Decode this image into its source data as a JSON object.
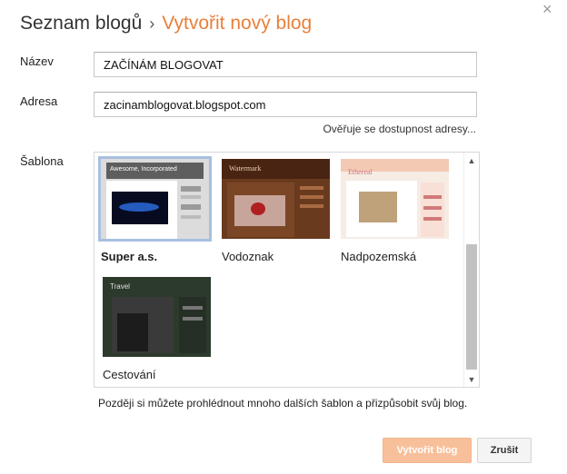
{
  "header": {
    "crumb": "Seznam blogů",
    "separator": "›",
    "current": "Vytvořit nový blog",
    "close_glyph": "×"
  },
  "form": {
    "name_label": "Název",
    "name_value": "ZAČÍNÁM BLOGOVAT",
    "address_label": "Adresa",
    "address_value": "zacinamblogovat.blogspot.com",
    "availability_hint": "Ověřuje se dostupnost adresy...",
    "template_label": "Šablona"
  },
  "templates": [
    {
      "name": "Super a.s.",
      "selected": true,
      "thumb_title": "Awesome, Incorporated"
    },
    {
      "name": "Vodoznak",
      "selected": false,
      "thumb_title": "Watermark"
    },
    {
      "name": "Nadpozemská",
      "selected": false,
      "thumb_title": "Ethereal"
    },
    {
      "name": "Cestování",
      "selected": false,
      "thumb_title": "Travel"
    }
  ],
  "footer_note": "Později si můžete prohlédnout mnoho dalších šablon a přizpůsobit svůj blog.",
  "buttons": {
    "create": "Vytvořit blog",
    "cancel": "Zrušit"
  },
  "scrollbar": {
    "up_arrow": "▲",
    "down_arrow": "▼"
  },
  "colors": {
    "accent": "#e8803a",
    "create_button_bg": "#f8c09a",
    "selected_outline": "#a8c0e0"
  }
}
